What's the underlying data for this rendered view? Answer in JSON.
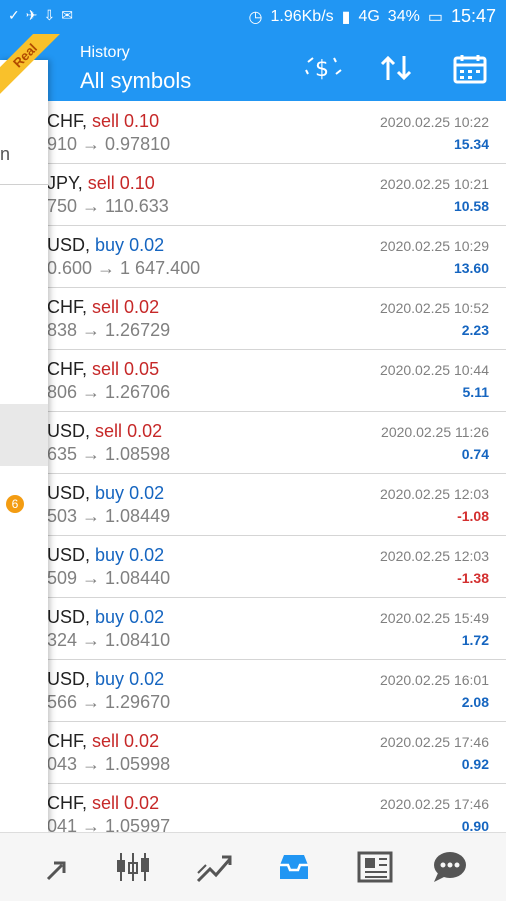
{
  "status_bar": {
    "net_speed": "1.96Kb/s",
    "signal": "4G",
    "battery": "34%",
    "time": "15:47"
  },
  "account_badge": "Real",
  "header": {
    "subtitle": "History",
    "title": "All symbols"
  },
  "toolbar": {
    "icons": [
      "currency-exchange-icon",
      "sort-icon",
      "calendar-icon"
    ]
  },
  "trades": [
    {
      "symbol": "CHF",
      "side": "sell",
      "volume": "0.10",
      "prices": "910 → 0.97810",
      "time": "2020.02.25 10:22",
      "profit": "15.34"
    },
    {
      "symbol": "JPY",
      "side": "sell",
      "volume": "0.10",
      "prices": "750 → 110.633",
      "time": "2020.02.25 10:21",
      "profit": "10.58"
    },
    {
      "symbol": "USD",
      "side": "buy",
      "volume": "0.02",
      "prices": "0.600 → 1 647.400",
      "time": "2020.02.25 10:29",
      "profit": "13.60"
    },
    {
      "symbol": "CHF",
      "side": "sell",
      "volume": "0.02",
      "prices": "838 → 1.26729",
      "time": "2020.02.25 10:52",
      "profit": "2.23"
    },
    {
      "symbol": "CHF",
      "side": "sell",
      "volume": "0.05",
      "prices": "806 → 1.26706",
      "time": "2020.02.25 10:44",
      "profit": "5.11"
    },
    {
      "symbol": "USD",
      "side": "sell",
      "volume": "0.02",
      "prices": "635 → 1.08598",
      "time": "2020.02.25 11:26",
      "profit": "0.74"
    },
    {
      "symbol": "USD",
      "side": "buy",
      "volume": "0.02",
      "prices": "503 → 1.08449",
      "time": "2020.02.25 12:03",
      "profit": "-1.08"
    },
    {
      "symbol": "USD",
      "side": "buy",
      "volume": "0.02",
      "prices": "509 → 1.08440",
      "time": "2020.02.25 12:03",
      "profit": "-1.38"
    },
    {
      "symbol": "USD",
      "side": "buy",
      "volume": "0.02",
      "prices": "324 → 1.08410",
      "time": "2020.02.25 15:49",
      "profit": "1.72"
    },
    {
      "symbol": "USD",
      "side": "buy",
      "volume": "0.02",
      "prices": "566 → 1.29670",
      "time": "2020.02.25 16:01",
      "profit": "2.08"
    },
    {
      "symbol": "CHF",
      "side": "sell",
      "volume": "0.02",
      "prices": "043 → 1.05998",
      "time": "2020.02.25 17:46",
      "profit": "0.92"
    },
    {
      "symbol": "CHF",
      "side": "sell",
      "volume": "0.02",
      "prices": "041 → 1.05997",
      "time": "2020.02.25 17:46",
      "profit": "0.90"
    }
  ],
  "drawer": {
    "partial_text": "n",
    "notification_count": "6"
  },
  "bottom_nav": [
    {
      "icon": "quotes-icon",
      "active": false
    },
    {
      "icon": "chart-icon",
      "active": false
    },
    {
      "icon": "trade-icon",
      "active": false
    },
    {
      "icon": "history-icon",
      "active": true
    },
    {
      "icon": "news-icon",
      "active": false
    },
    {
      "icon": "chat-icon",
      "active": false
    }
  ],
  "colors": {
    "primary": "#2196f3",
    "sell": "#c62828",
    "buy": "#1565c0",
    "profit_positive": "#1565c0",
    "profit_negative": "#d32f2f",
    "nav_icon": "#555555",
    "nav_active": "#2196f3",
    "badge": "#f9c12b"
  }
}
